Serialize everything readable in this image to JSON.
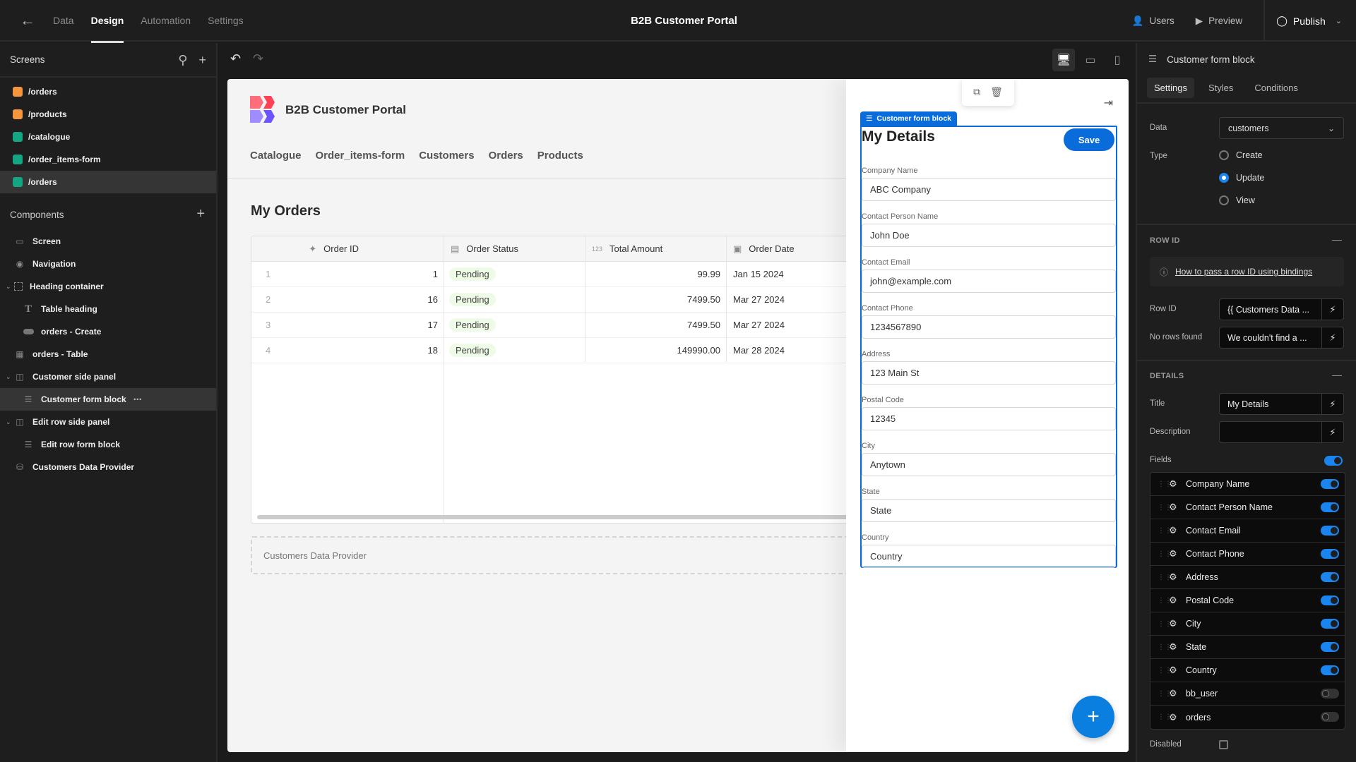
{
  "topbar": {
    "tabs": [
      {
        "label": "Data",
        "active": false
      },
      {
        "label": "Design",
        "active": true
      },
      {
        "label": "Automation",
        "active": false
      },
      {
        "label": "Settings",
        "active": false
      }
    ],
    "app_title": "B2B Customer Portal",
    "users_label": "Users",
    "preview_label": "Preview",
    "publish_label": "Publish"
  },
  "left": {
    "screens_title": "Screens",
    "screens": [
      {
        "route": "/orders",
        "color": "#f5953f",
        "selected": false
      },
      {
        "route": "/products",
        "color": "#f5953f",
        "selected": false
      },
      {
        "route": "/catalogue",
        "color": "#14a683",
        "selected": false
      },
      {
        "route": "/order_items-form",
        "color": "#14a683",
        "selected": false
      },
      {
        "route": "/orders",
        "color": "#14a683",
        "selected": true
      }
    ],
    "components_title": "Components",
    "components": [
      {
        "label": "Screen",
        "icon": "screen-icon",
        "level": 0
      },
      {
        "label": "Navigation",
        "icon": "eye-icon",
        "level": 0
      },
      {
        "label": "Heading container",
        "icon": "container-icon",
        "level": 0,
        "expanded": true
      },
      {
        "label": "Table heading",
        "icon": "text-icon",
        "level": 1
      },
      {
        "label": "orders - Create",
        "icon": "button-icon",
        "level": 1
      },
      {
        "label": "orders - Table",
        "icon": "table-icon",
        "level": 0
      },
      {
        "label": "Customer side panel",
        "icon": "side-panel-icon",
        "level": 0,
        "expanded": true
      },
      {
        "label": "Customer form block",
        "icon": "form-icon",
        "level": 1,
        "selected": true
      },
      {
        "label": "Edit row side panel",
        "icon": "side-panel-icon",
        "level": 0,
        "expanded": true
      },
      {
        "label": "Edit row form block",
        "icon": "form-icon",
        "level": 1
      },
      {
        "label": "Customers Data Provider",
        "icon": "database-icon",
        "level": 0
      }
    ]
  },
  "canvas": {
    "app_name": "B2B Customer Portal",
    "nav": [
      "Catalogue",
      "Order_items-form",
      "Customers",
      "Orders",
      "Products"
    ],
    "heading": "My Orders",
    "table": {
      "columns": [
        {
          "label": "Order ID",
          "icon": "magic-wand-icon"
        },
        {
          "label": "Order Status",
          "icon": "options-icon"
        },
        {
          "label": "Total Amount",
          "icon": "number-icon",
          "icon_text": "123"
        },
        {
          "label": "Order Date",
          "icon": "calendar-icon"
        }
      ],
      "rows": [
        {
          "n": "1",
          "id": "1",
          "status": "Pending",
          "amount": "99.99",
          "date": "Jan 15 2024"
        },
        {
          "n": "2",
          "id": "16",
          "status": "Pending",
          "amount": "7499.50",
          "date": "Mar 27 2024"
        },
        {
          "n": "3",
          "id": "17",
          "status": "Pending",
          "amount": "7499.50",
          "date": "Mar 27 2024"
        },
        {
          "n": "4",
          "id": "18",
          "status": "Pending",
          "amount": "149990.00",
          "date": "Mar 28 2024"
        }
      ]
    },
    "data_provider_label": "Customers Data Provider",
    "side_panel": {
      "block_tag": "Customer form block",
      "form_title": "My Details",
      "save_label": "Save",
      "fields": [
        {
          "label": "Company Name",
          "value": "ABC Company"
        },
        {
          "label": "Contact Person Name",
          "value": "John Doe"
        },
        {
          "label": "Contact Email",
          "value": "john@example.com"
        },
        {
          "label": "Contact Phone",
          "value": "1234567890"
        },
        {
          "label": "Address",
          "value": "123 Main St"
        },
        {
          "label": "Postal Code",
          "value": "12345"
        },
        {
          "label": "City",
          "value": "Anytown"
        },
        {
          "label": "State",
          "value": "State"
        },
        {
          "label": "Country",
          "value": "Country"
        }
      ]
    }
  },
  "right": {
    "title": "Customer form block",
    "tabs": [
      "Settings",
      "Styles",
      "Conditions"
    ],
    "data_label": "Data",
    "data_value": "customers",
    "type_label": "Type",
    "type_options": [
      {
        "label": "Create",
        "checked": false
      },
      {
        "label": "Update",
        "checked": true
      },
      {
        "label": "View",
        "checked": false
      }
    ],
    "row_id_section": "ROW ID",
    "help_link": "How to pass a row ID using bindings",
    "row_id_label": "Row ID",
    "row_id_value": "{{ Customers Data ...",
    "no_rows_label": "No rows found",
    "no_rows_value": "We couldn't find a ...",
    "details_section": "DETAILS",
    "title_label": "Title",
    "title_value": "My Details",
    "description_label": "Description",
    "description_value": "",
    "fields_label": "Fields",
    "fields_enabled": true,
    "field_list": [
      {
        "label": "Company Name",
        "on": true
      },
      {
        "label": "Contact Person Name",
        "on": true
      },
      {
        "label": "Contact Email",
        "on": true
      },
      {
        "label": "Contact Phone",
        "on": true
      },
      {
        "label": "Address",
        "on": true
      },
      {
        "label": "Postal Code",
        "on": true
      },
      {
        "label": "City",
        "on": true
      },
      {
        "label": "State",
        "on": true
      },
      {
        "label": "Country",
        "on": true
      },
      {
        "label": "bb_user",
        "on": false
      },
      {
        "label": "orders",
        "on": false
      }
    ],
    "disabled_label": "Disabled",
    "disabled_checked": false
  }
}
